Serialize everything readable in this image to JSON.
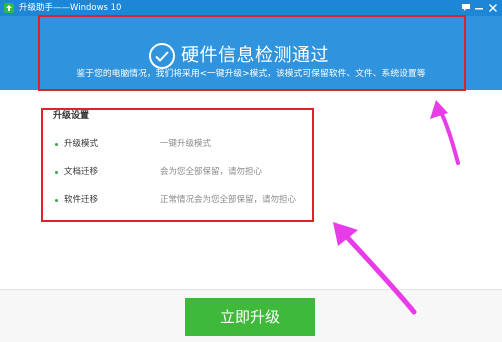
{
  "titlebar": {
    "title": "升级助手——Windows 10",
    "chat_icon": "chat-icon",
    "minimize_icon": "minimize-icon",
    "close_icon": "close-icon",
    "chat_glyph": "💬",
    "minimize_glyph": "—",
    "close_glyph": "✕"
  },
  "header": {
    "headline": "硬件信息检测通过",
    "subtitle": "鉴于您的电脑情况，我们将采用<一键升级>模式，该模式可保留软件、文件、系统设置等"
  },
  "settings": {
    "title": "升级设置",
    "rows": [
      {
        "key": "升级模式",
        "value": "一键升级模式"
      },
      {
        "key": "文档迁移",
        "value": "会为您全部保留，请勿担心"
      },
      {
        "key": "软件迁移",
        "value": "正常情况会为您全部保留，请勿担心"
      }
    ]
  },
  "footer": {
    "upgrade_button": "立即升级"
  },
  "colors": {
    "titlebar": "#1e86d6",
    "header": "#2f94dd",
    "annotation_red": "#e0202c",
    "annotation_arrow": "#e83ce8",
    "button_green": "#3fb93a"
  }
}
